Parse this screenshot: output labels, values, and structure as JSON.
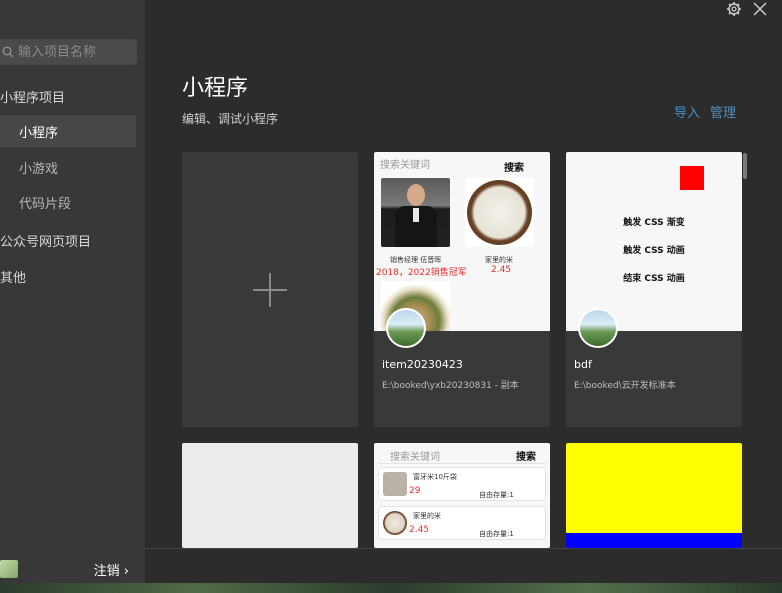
{
  "sidebar": {
    "search_placeholder": "输入项目名称",
    "groups": [
      {
        "label": "小程序项目"
      },
      {
        "label": "公众号网页项目"
      },
      {
        "label": "其他"
      }
    ],
    "items": [
      {
        "label": "小程序"
      },
      {
        "label": "小游戏"
      },
      {
        "label": "代码片段"
      }
    ],
    "logout_label": "注销 ›"
  },
  "main": {
    "title": "小程序",
    "subtitle": "编辑、调试小程序",
    "import_label": "导入",
    "manage_label": "管理"
  },
  "cards": [
    {
      "name": "item20230423",
      "path": "E:\\booked\\yxb20230831 - 副本",
      "preview": {
        "search_placeholder": "搜索关键词",
        "search_button": "搜索",
        "caption1": "销售经理 伍晋晖",
        "red1": "2018，2022销售冠军",
        "caption2": "家里的米",
        "red2": "2.45"
      }
    },
    {
      "name": "bdf",
      "path": "E:\\booked\\云开发标准本",
      "preview": {
        "line1": "触发 CSS 渐变",
        "line2": "触发 CSS 动画",
        "line3": "结束 CSS 动画"
      }
    }
  ],
  "cards_row2": {
    "card2": {
      "search_placeholder": "搜索关键词",
      "search_button": "搜索",
      "item1_name": "富牙米10斤袋",
      "item1_price": "29",
      "item1_stock": "自由存量:1",
      "item2_name": "家里的米",
      "item2_price": "2.45",
      "item2_stock": "自由存量:1"
    }
  },
  "colors": {
    "accent_link": "#4a8fc7",
    "price_red": "#e03030",
    "card3_top": "#ffff00",
    "card3_bottom": "#0000ff"
  }
}
